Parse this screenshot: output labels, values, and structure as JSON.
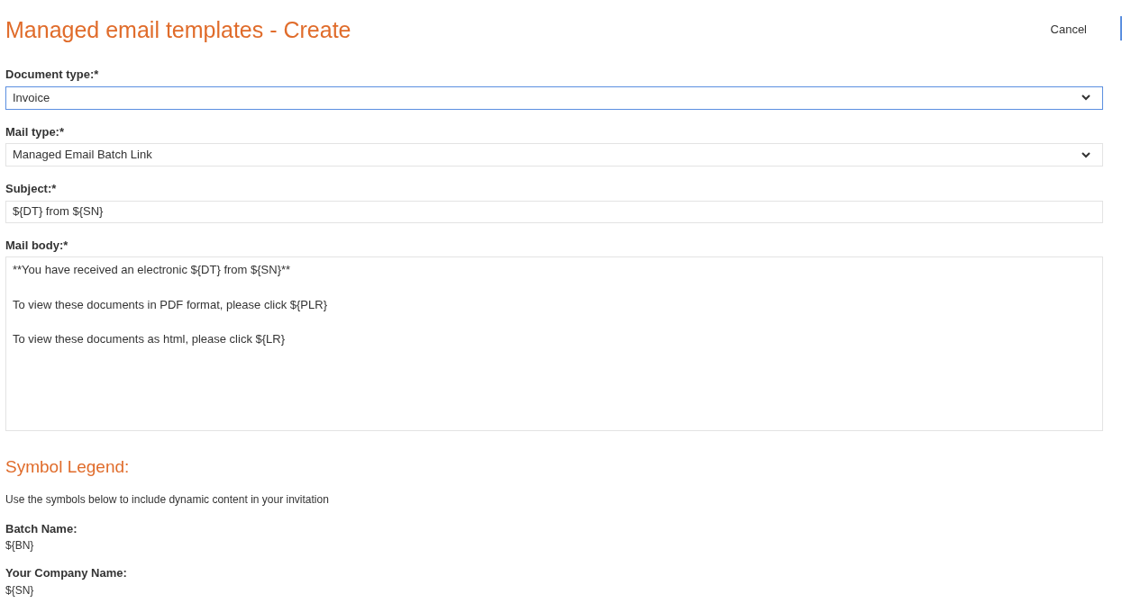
{
  "page": {
    "title": "Managed email templates - Create",
    "cancel": "Cancel"
  },
  "fields": [
    {
      "kind": "select",
      "label": "Document type:*",
      "value": "Invoice",
      "focused": true
    },
    {
      "kind": "select",
      "label": "Mail type:*",
      "value": "Managed Email Batch Link",
      "focused": false
    },
    {
      "kind": "text",
      "label": "Subject:*",
      "value": "${DT} from ${SN}",
      "focused": false
    },
    {
      "kind": "textarea",
      "label": "Mail body:*",
      "lines": [
        "**You have received an electronic ${DT} from ${SN}**",
        "To view these documents in PDF format, please click ${PLR}",
        "To view these documents as html, please click ${LR}"
      ],
      "focused": false
    }
  ],
  "legend": {
    "title": "Symbol Legend:",
    "intro": "Use the symbols below to include dynamic content in your invitation",
    "symbols": [
      {
        "name": "Batch Name:",
        "symbol": "${BN}"
      },
      {
        "name": "Your Company Name:",
        "symbol": "${SN}"
      }
    ]
  }
}
